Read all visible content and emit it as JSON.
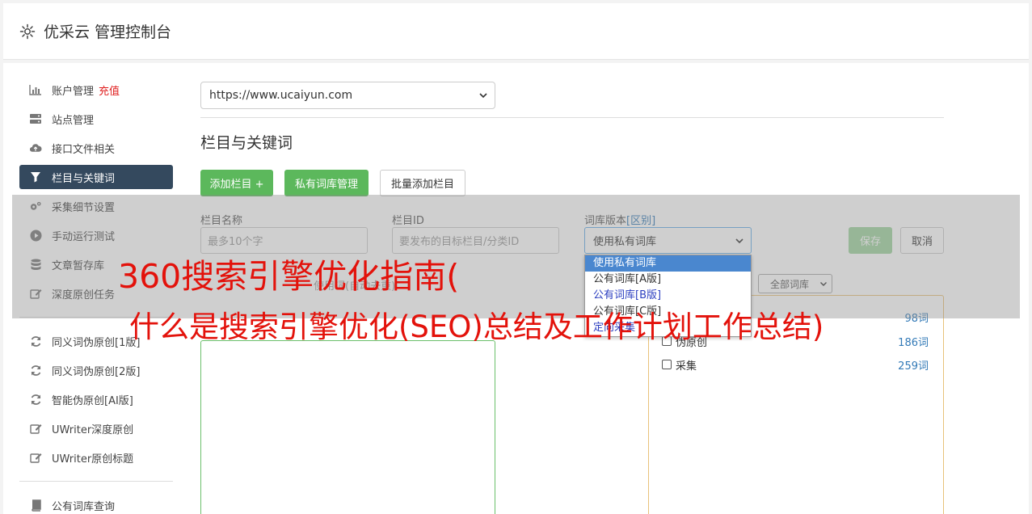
{
  "header": {
    "title": "优采云 管理控制台",
    "icon": "gear-icon"
  },
  "sidebar": {
    "items": [
      {
        "label": "账户管理",
        "badge": "充值",
        "icon": "bar-chart-icon"
      },
      {
        "label": "站点管理",
        "icon": "server-icon"
      },
      {
        "label": "接口文件相关",
        "icon": "cloud-upload-icon"
      },
      {
        "label": "栏目与关键词",
        "icon": "filter-icon",
        "active": true
      },
      {
        "label": "采集细节设置",
        "icon": "cogs-icon"
      },
      {
        "label": "手动运行测试",
        "icon": "play-circle-icon"
      },
      {
        "label": "文章暂存库",
        "icon": "database-icon"
      },
      {
        "label": "深度原创任务",
        "icon": "edit-icon"
      }
    ],
    "items2": [
      {
        "label": "同义词伪原创[1版]",
        "icon": "refresh-icon"
      },
      {
        "label": "同义词伪原创[2版]",
        "icon": "refresh-icon"
      },
      {
        "label": "智能伪原创[AI版]",
        "icon": "refresh-icon"
      },
      {
        "label": "UWriter深度原创",
        "icon": "edit-icon"
      },
      {
        "label": "UWriter原创标题",
        "icon": "edit-icon"
      }
    ],
    "items3": [
      {
        "label": "公有词库查询",
        "icon": "book-icon"
      }
    ]
  },
  "main": {
    "site_select": "https://www.ucaiyun.com",
    "section_title": "栏目与关键词",
    "buttons": {
      "add_column": "添加栏目 +",
      "private_lib": "私有词库管理",
      "batch_add": "批量添加栏目"
    },
    "form": {
      "name_label": "栏目名称",
      "name_placeholder": "最多10个字",
      "id_label": "栏目ID",
      "id_placeholder": "要发布的目标栏目/分类ID",
      "version_label": "词库版本",
      "version_diff": "[区别]",
      "version_value": "使用私有词库",
      "save": "保存",
      "cancel": "取消"
    },
    "dropdown_options": [
      "使用私有词库",
      "公有词库[A版]",
      "公有词库[B版]",
      "公有词库[C版]",
      "定向采集"
    ],
    "below_label": "使用词(自动去重)",
    "filter_select": "全部词库",
    "libraries": [
      {
        "name": "",
        "count": "98词"
      },
      {
        "name": "伪原创",
        "count": "186词"
      },
      {
        "name": "采集",
        "count": "259词"
      }
    ]
  },
  "banner": {
    "line1": "360搜索引擎优化指南(",
    "line2": "什么是搜索引擎优化(SEO)总结及工作计划工作总结)"
  }
}
